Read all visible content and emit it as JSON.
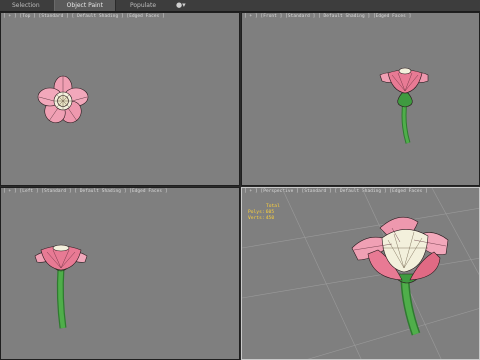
{
  "toolbar": {
    "tabs": [
      {
        "label": "Selection",
        "active": false
      },
      {
        "label": "Object Paint",
        "active": true
      },
      {
        "label": "Populate",
        "active": false
      }
    ],
    "eye_icon": "eye-icon",
    "eye_menu": "▾"
  },
  "viewports": {
    "top": {
      "label": "[ + ] [Top ] [Standard ] [ Default Shading ] [Edged Faces ]"
    },
    "front": {
      "label": "[ + ] [Front ] [Standard ] [ Default Shading ] [Edged Faces ]"
    },
    "left": {
      "label": "[ + ] [Left ] [Standard ] [ Default Shading ] [Edged Faces ]"
    },
    "perspective": {
      "label": "[ + ] [Perspective ] [Standard ] [ Default Shading ] [Edged Faces ]",
      "stats": {
        "header": "Total",
        "rows": [
          {
            "name": "Polys:",
            "value": "605"
          },
          {
            "name": "Verts:",
            "value": "450"
          }
        ]
      }
    }
  },
  "colors": {
    "viewport_bg": "#7f7f7f",
    "petal": "#f0a0b4",
    "petal_dark": "#e06a84",
    "stem": "#3f9a40",
    "stats_text": "#ffd23a"
  }
}
